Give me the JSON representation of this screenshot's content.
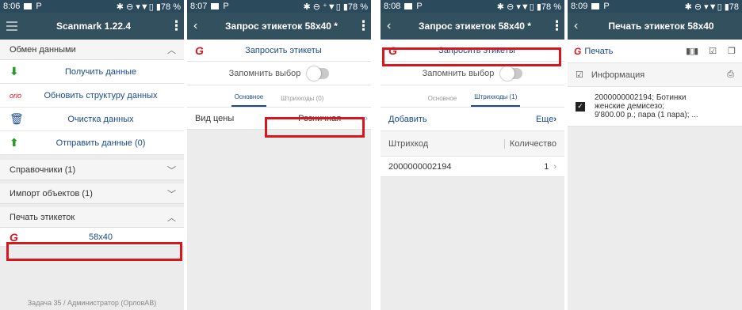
{
  "screens": [
    {
      "status": {
        "time": "8:06",
        "right": "✱ ⊖ ▾▼▯ ▮78 %"
      },
      "appbar": {
        "title": "Scanmark 1.22.4"
      },
      "exchange": {
        "label": "Обмен данными",
        "items": [
          {
            "label": "Получить данные",
            "icon": "download-icon"
          },
          {
            "label": "Обновить структуру данных",
            "icon": "orio-logo-icon"
          },
          {
            "label": "Очистка данных",
            "icon": "trash-icon"
          },
          {
            "label": "Отправить данные (0)",
            "icon": "upload-icon"
          }
        ]
      },
      "sections": [
        {
          "label": "Справочники (1)"
        },
        {
          "label": "Импорт объектов (1)"
        },
        {
          "label": "Печать этикеток"
        }
      ],
      "label_item": "58x40",
      "footer": "Задача 35 / Администратор (ОрловАВ)"
    },
    {
      "status": {
        "time": "8:07",
        "right": "✱ ⊖ ⁺▼▯ ▮78 %"
      },
      "appbar": {
        "title": "Запрос этикеток 58x40 *"
      },
      "request_label": "Запросить этикеты",
      "remember_label": "Запомнить выбор",
      "tabs": [
        "Основное",
        "Штрихкоды (0)"
      ],
      "price_label": "Вид цены",
      "price_value": "Розничная"
    },
    {
      "status": {
        "time": "8:08",
        "right": "✱ ⊖ ▾▼▯ ▮78 %"
      },
      "appbar": {
        "title": "Запрос этикеток 58x40 *"
      },
      "request_label": "Запросить этикеты",
      "remember_label": "Запомнить выбор",
      "tabs": [
        "Основное",
        "Штрихкоды (1)"
      ],
      "add_label": "Добавить",
      "more_label": "Еще",
      "col_barcode": "Штрихкод",
      "col_qty": "Количество",
      "row": {
        "barcode": "2000000002194",
        "qty": "1"
      }
    },
    {
      "status": {
        "time": "8:09",
        "right": "✱ ⊖ ▾▼▯ ▮78"
      },
      "appbar": {
        "title": "Печать этикеток 58x40"
      },
      "print_label": "Печать",
      "info_header": "Информация",
      "item_lines": [
        "2000000002194; Ботинки",
        "женские демисезо;",
        "9'800.00 р.; пара (1 пара); ..."
      ]
    }
  ],
  "colors": {
    "statusbar": "#2b4a5c",
    "appbar": "#33505f",
    "highlight": "#d8161e",
    "link": "#1a4a8a",
    "icon_green": "#2a9a2a"
  }
}
